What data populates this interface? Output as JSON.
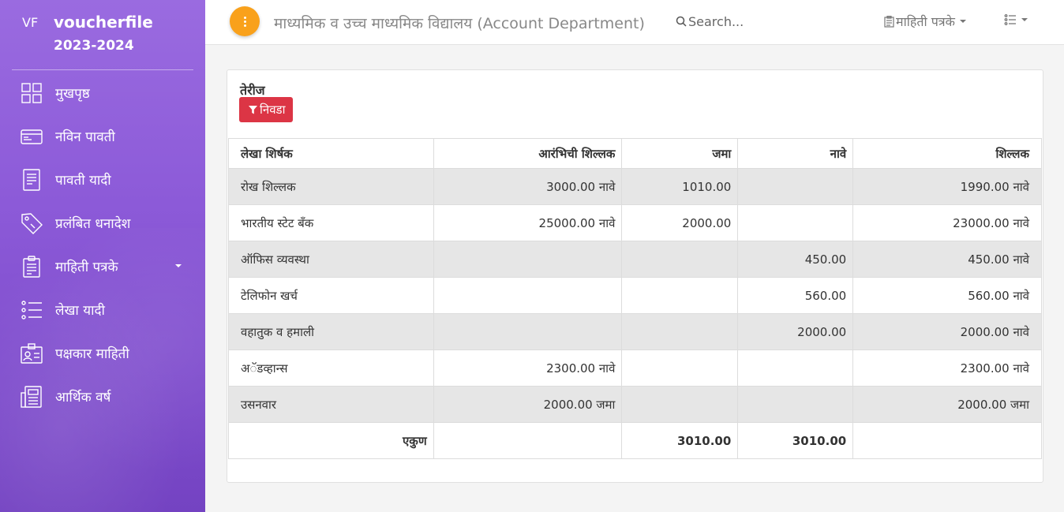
{
  "app": {
    "abbr": "VF",
    "name": "voucherfile",
    "year": "2023-2024"
  },
  "sidebar": {
    "items": [
      {
        "label": "मुखपृष्ठ",
        "icon": "grid-icon"
      },
      {
        "label": "नविन पावती",
        "icon": "card-icon"
      },
      {
        "label": "पावती यादी",
        "icon": "document-list-icon"
      },
      {
        "label": "प्रलंबित धनादेश",
        "icon": "tag-icon"
      },
      {
        "label": "माहिती पत्रके",
        "icon": "clipboard-icon",
        "has_submenu": true
      },
      {
        "label": "लेखा यादी",
        "icon": "list-icon"
      },
      {
        "label": "पक्षकार माहिती",
        "icon": "id-card-icon"
      },
      {
        "label": "आर्थिक वर्ष",
        "icon": "calendar-report-icon"
      }
    ]
  },
  "header": {
    "title": "माध्यमिक व उच्च माध्यमिक विद्यालय (Account Department)",
    "search_placeholder": "Search...",
    "reports_menu": "माहिती पत्रके",
    "accent_color": "#f9a11b"
  },
  "card": {
    "title": "तेरीज",
    "filter_label": "निवडा",
    "filter_color": "#dc3545"
  },
  "table": {
    "headers": [
      "लेखा शिर्षक",
      "आरंभिची शिल्लक",
      "जमा",
      "नावे",
      "शिल्लक"
    ],
    "rows": [
      [
        "रोख शिल्लक",
        "3000.00 नावे",
        "1010.00",
        "",
        "1990.00 नावे"
      ],
      [
        "भारतीय स्टेट बँक",
        "25000.00 नावे",
        "2000.00",
        "",
        "23000.00 नावे"
      ],
      [
        "ऑफिस व्यवस्था",
        "",
        "",
        "450.00",
        "450.00 नावे"
      ],
      [
        "टेलिफोन खर्च",
        "",
        "",
        "560.00",
        "560.00 नावे"
      ],
      [
        "वहातुक व हमाली",
        "",
        "",
        "2000.00",
        "2000.00 नावे"
      ],
      [
        "अॅडव्हान्स",
        "2300.00 नावे",
        "",
        "",
        "2300.00 नावे"
      ],
      [
        "उसनवार",
        "2000.00 जमा",
        "",
        "",
        "2000.00 जमा"
      ]
    ],
    "total": [
      "एकुण",
      "",
      "3010.00",
      "3010.00",
      ""
    ]
  }
}
